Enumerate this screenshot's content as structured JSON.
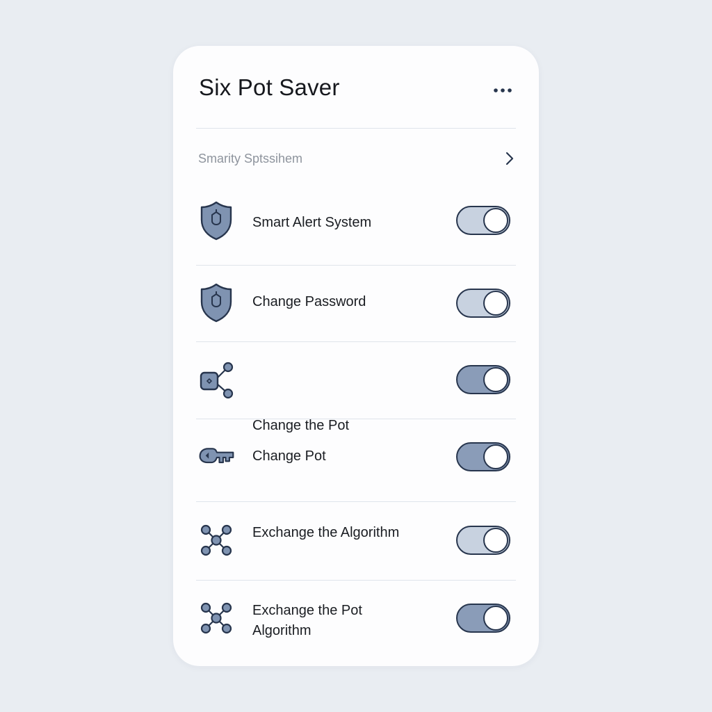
{
  "header": {
    "title": "Six Pot Saver",
    "more_icon": "more-horizontal-icon"
  },
  "section": {
    "label": "Smarity Sptssihem",
    "chevron_icon": "chevron-right-icon"
  },
  "colors": {
    "icon_fill": "#7f93b1",
    "icon_stroke": "#27354d",
    "toggle_track_light": "#c8d2e0",
    "toggle_track_dark": "#8a9cb8"
  },
  "settings": [
    {
      "label": "Smart Alert System",
      "icon": "shield-icon",
      "toggle_on": true
    },
    {
      "label": "Change Password",
      "icon": "shield-icon",
      "toggle_on": true
    },
    {
      "label": "Change the Pot",
      "icon": "share-node-icon",
      "toggle_on": true
    },
    {
      "label": "Change Pot",
      "icon": "key-icon",
      "toggle_on": true
    },
    {
      "label": "Exchange the Algorithm",
      "icon": "network-icon",
      "toggle_on": true
    },
    {
      "label": "Exchange the Pot Algorithm",
      "icon": "network-icon",
      "toggle_on": true
    }
  ]
}
